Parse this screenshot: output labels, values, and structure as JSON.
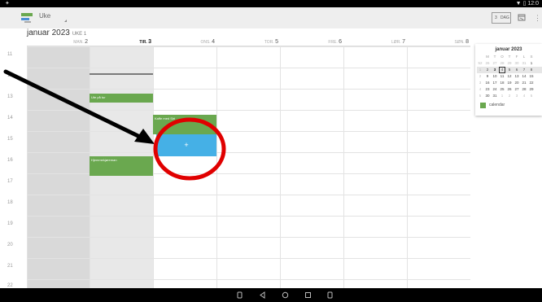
{
  "status_bar": {
    "time": "12:0"
  },
  "app_bar": {
    "view_selector": "Uke",
    "today_button_number": "3",
    "today_button_label": "DAG"
  },
  "header": {
    "month_title": "januar 2023",
    "week_label": "UKE 1"
  },
  "days": [
    {
      "name": "MAN.",
      "num": "2"
    },
    {
      "name": "TIR.",
      "num": "3"
    },
    {
      "name": "ONS.",
      "num": "4"
    },
    {
      "name": "TOR.",
      "num": "5"
    },
    {
      "name": "FRE.",
      "num": "6"
    },
    {
      "name": "LØR.",
      "num": "7"
    },
    {
      "name": "SØN.",
      "num": "8"
    }
  ],
  "hours": [
    "11",
    "12",
    "13",
    "14",
    "15",
    "16",
    "17",
    "18",
    "19",
    "20",
    "21",
    "22"
  ],
  "events": [
    {
      "title": "Ute på tur"
    },
    {
      "title": "Kaffe med Siri"
    },
    {
      "title": "Hjemmekjøreman"
    }
  ],
  "new_event_symbol": "+",
  "mini_calendar": {
    "title": "januar 2023",
    "weekday_headers": [
      "",
      "M",
      "T",
      "O",
      "T",
      "F",
      "L",
      "S"
    ],
    "rows": [
      [
        "52",
        "26",
        "27",
        "28",
        "29",
        "30",
        "31",
        "1"
      ],
      [
        "1",
        "2",
        "3",
        "4",
        "5",
        "6",
        "7",
        "8"
      ],
      [
        "2",
        "9",
        "10",
        "11",
        "12",
        "13",
        "14",
        "15"
      ],
      [
        "3",
        "16",
        "17",
        "18",
        "19",
        "20",
        "21",
        "22"
      ],
      [
        "4",
        "23",
        "24",
        "25",
        "26",
        "27",
        "28",
        "29"
      ],
      [
        "5",
        "30",
        "31",
        "1",
        "2",
        "3",
        "4",
        "5"
      ]
    ],
    "legend_label": "calendar"
  },
  "colors": {
    "event_green": "#6aa84f",
    "new_event_blue": "#45b0e6",
    "annotation_red": "#e00000",
    "annotation_arrow": "#000000"
  },
  "icons": {
    "app_logo": "calendar-logo-icon",
    "goto_date": "goto-date-icon",
    "more": "more-vert-icon",
    "nav_back": "back-icon",
    "nav_home": "home-icon",
    "nav_recents": "recents-icon",
    "nav_screenshot": "screenshot-icon"
  }
}
